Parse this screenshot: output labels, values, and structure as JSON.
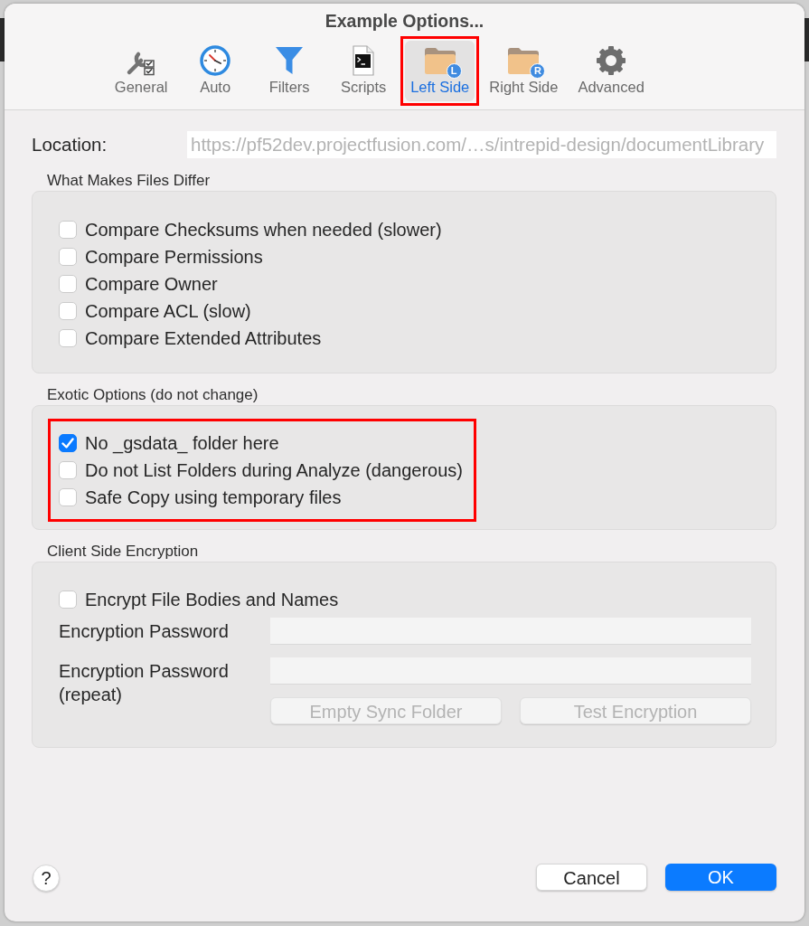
{
  "window": {
    "title": "Example Options..."
  },
  "tabs": [
    {
      "label": "General",
      "selected": false,
      "highlighted": false
    },
    {
      "label": "Auto",
      "selected": false,
      "highlighted": false
    },
    {
      "label": "Filters",
      "selected": false,
      "highlighted": false
    },
    {
      "label": "Scripts",
      "selected": false,
      "highlighted": false
    },
    {
      "label": "Left Side",
      "selected": true,
      "highlighted": true,
      "badge": "L"
    },
    {
      "label": "Right Side",
      "selected": false,
      "highlighted": false,
      "badge": "R"
    },
    {
      "label": "Advanced",
      "selected": false,
      "highlighted": false
    }
  ],
  "location": {
    "label": "Location:",
    "value": "https://pf52dev.projectfusion.com/…s/intrepid-design/documentLibrary",
    "disabled": true
  },
  "sections": [
    {
      "title": "What Makes Files Differ",
      "highlighted": false,
      "options": [
        {
          "label": "Compare Checksums when needed (slower)",
          "checked": false
        },
        {
          "label": "Compare Permissions",
          "checked": false
        },
        {
          "label": "Compare Owner",
          "checked": false
        },
        {
          "label": "Compare ACL (slow)",
          "checked": false
        },
        {
          "label": "Compare Extended Attributes",
          "checked": false
        }
      ]
    },
    {
      "title": "Exotic Options (do not change)",
      "highlighted": true,
      "options": [
        {
          "label": "No _gsdata_ folder here",
          "checked": true
        },
        {
          "label": "Do not List Folders during Analyze (dangerous)",
          "checked": false
        },
        {
          "label": "Safe Copy using temporary files",
          "checked": false
        }
      ]
    }
  ],
  "encryption": {
    "title": "Client Side Encryption",
    "options": [
      {
        "label": "Encrypt File Bodies and Names",
        "checked": false
      }
    ],
    "fields": [
      {
        "label": "Encryption Password",
        "disabled": true
      },
      {
        "label": "Encryption Password (repeat)",
        "disabled": true
      }
    ],
    "buttons": [
      {
        "label": "Empty Sync Folder",
        "disabled": true
      },
      {
        "label": "Test Encryption",
        "disabled": true
      }
    ]
  },
  "footer": {
    "help": "?",
    "buttons": [
      {
        "label": "Cancel",
        "primary": false
      },
      {
        "label": "OK",
        "primary": true
      }
    ]
  }
}
